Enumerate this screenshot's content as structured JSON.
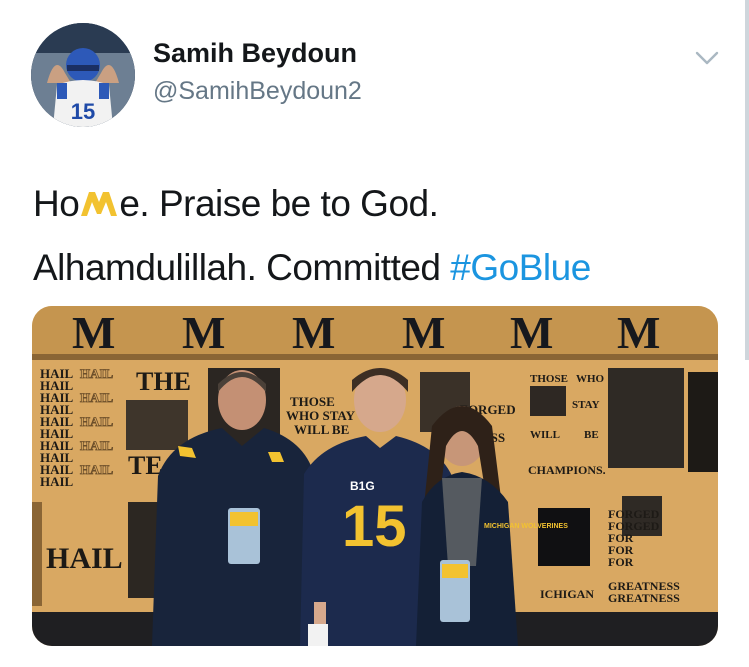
{
  "user": {
    "display_name": "Samih Beydoun",
    "handle": "@SamihBeydoun2",
    "avatar_jersey_number": "15"
  },
  "tweet": {
    "text_part1": "Ho",
    "text_part2": "e. Praise be to God.",
    "text_line2": "Alhamdulillah. Committed ",
    "hashtag": "#GoBlue",
    "emoji": "michigan-block-m-emoji"
  },
  "photo": {
    "banner_letter": "M",
    "wall_hail_word": "HAIL",
    "wall_the": "THE",
    "wall_those_who_stay_1": "THOSE",
    "wall_those_who_stay_2": "WHO STAY",
    "wall_those_who_stay_3": "WILL BE",
    "wall_forged_1": "FORGED",
    "wall_forged_2": "R",
    "wall_forged_3": "ESS",
    "wall_right_1": "THOSE",
    "wall_right_2": "WHO",
    "wall_right_3": "STAY",
    "wall_right_4": "WILL",
    "wall_right_5": "BE",
    "wall_champions": "CHAMPIONS.",
    "wall_forged_bottom_1": "FORGED",
    "wall_forged_bottom_2": "FORGED",
    "wall_forged_bottom_3": "FOR",
    "wall_forged_bottom_4": "FOR",
    "wall_forged_bottom_5": "FOR",
    "wall_greatness_1": "GREATNESS",
    "wall_greatness_2": "GREATNESS",
    "wall_michigan": "ICHIGAN",
    "wall_hail_big": "HAIL",
    "wall_te": "TE",
    "jersey_number": "15",
    "jersey_patch": "B1G",
    "jacket_badge": "MICHIGAN WOLVERINES"
  },
  "colors": {
    "text": "#14171a",
    "secondary": "#657786",
    "link": "#1b95e0",
    "maize": "#f2c230",
    "navy": "#0e1a33"
  }
}
